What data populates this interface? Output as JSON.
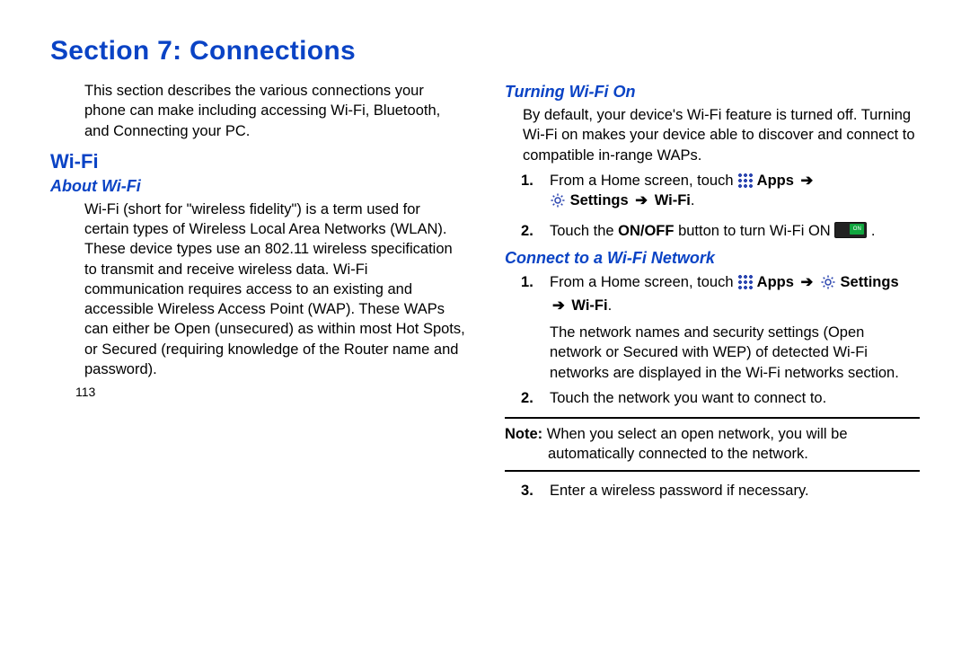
{
  "title": "Section 7: Connections",
  "intro": "This section describes the various connections your phone can make including accessing Wi-Fi, Bluetooth, and Connecting your PC.",
  "left": {
    "h_wifi": "Wi-Fi",
    "h_about": "About Wi-Fi",
    "about_body": "Wi-Fi (short for \"wireless fidelity\") is a term used for certain types of Wireless Local Area Networks (WLAN). These device types use an 802.11 wireless specification to transmit and receive wireless data. Wi-Fi communication requires access to an existing and accessible Wireless Access Point (WAP). These WAPs can either be Open (unsecured) as within most Hot Spots, or Secured (requiring knowledge of the Router name and password)."
  },
  "right": {
    "h_turn_on": "Turning Wi-Fi On",
    "turn_on_intro": "By default, your device's Wi-Fi feature is turned off. Turning Wi-Fi on makes your device able to discover and connect to compatible in-range WAPs.",
    "step1_pre": "From a Home screen, touch ",
    "apps_label": "Apps",
    "settings_label": "Settings",
    "wifi_label": "Wi-Fi",
    "arrow": "➔",
    "step2_pre": "Touch the ",
    "onoff_label": "ON/OFF",
    "step2_mid": " button to turn Wi-Fi ON ",
    "h_connect": "Connect to a Wi-Fi Network",
    "c1_pre": "From a Home screen, touch ",
    "c1_extra": "The network names and security settings (Open network or Secured with WEP) of detected Wi-Fi networks are displayed in the Wi-Fi networks section.",
    "c2": "Touch the network you want to connect to.",
    "note_label": "Note:",
    "note_body": " When you select an open network, you will be automatically connected to the network.",
    "c3": "Enter a wireless password if necessary."
  },
  "page_number": "113"
}
